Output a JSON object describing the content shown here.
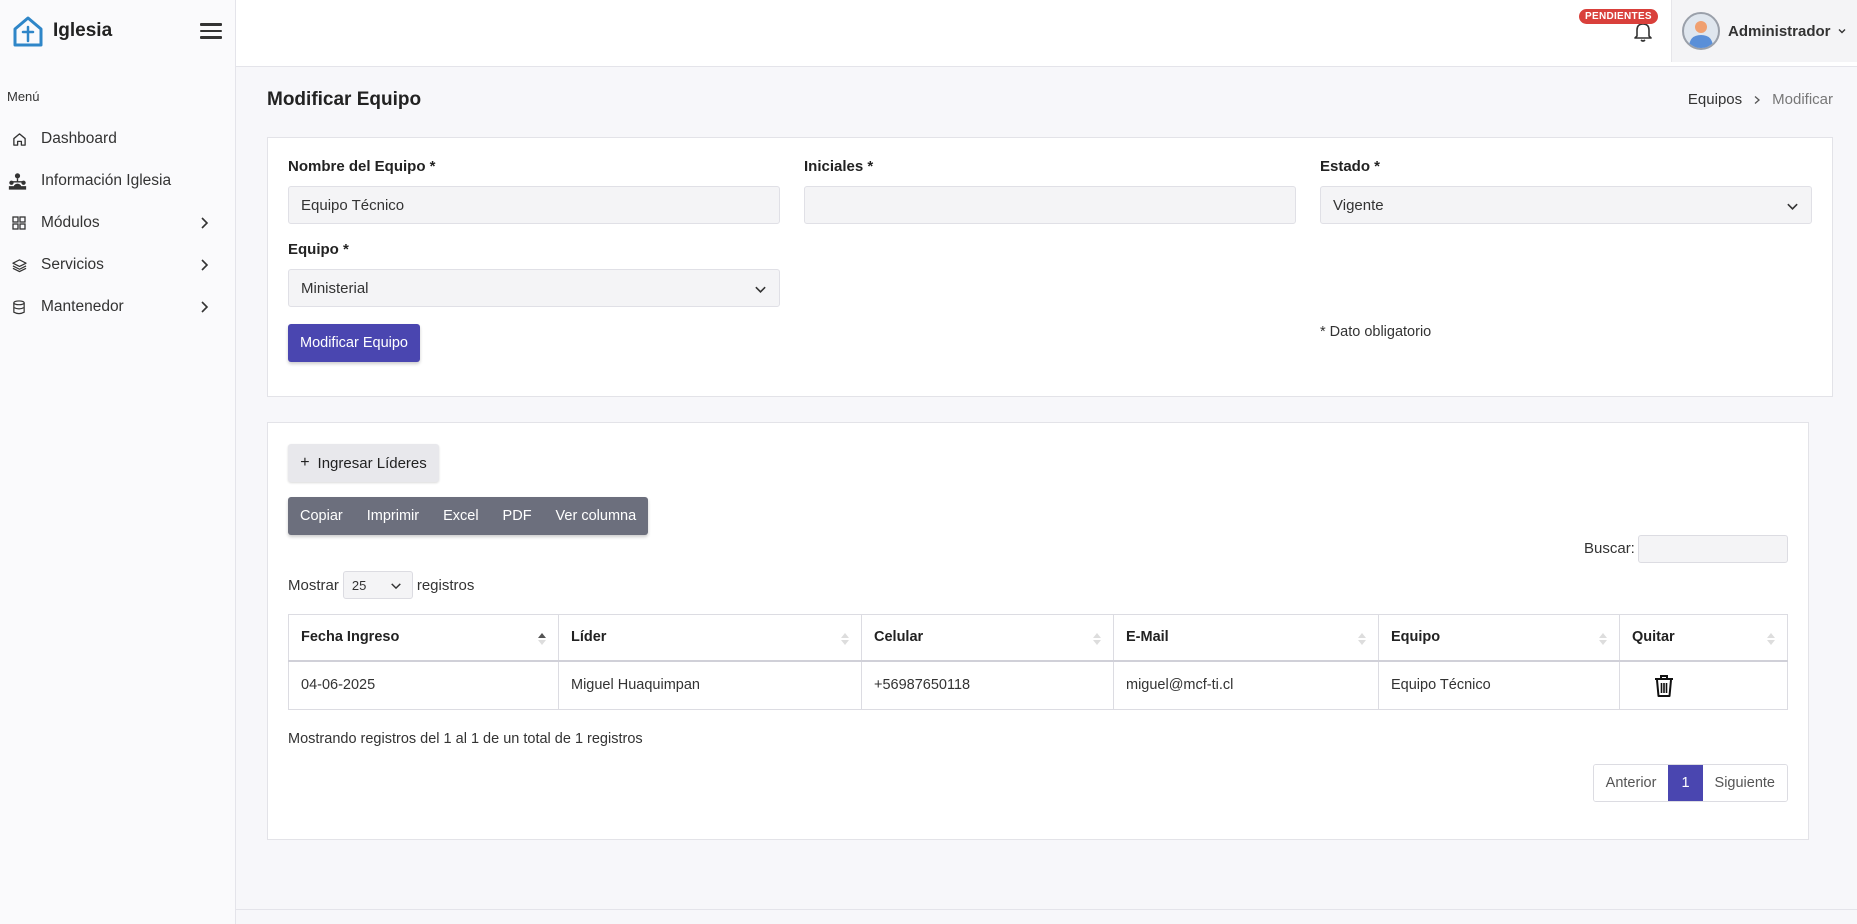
{
  "brand": {
    "name": "Iglesia"
  },
  "sidebar": {
    "menu_label": "Menú",
    "items": [
      {
        "label": "Dashboard",
        "icon": "home-icon",
        "has_children": false
      },
      {
        "label": "Información Iglesia",
        "icon": "church-org-icon",
        "has_children": false
      },
      {
        "label": "Módulos",
        "icon": "grid-icon",
        "has_children": true
      },
      {
        "label": "Servicios",
        "icon": "layers-icon",
        "has_children": true
      },
      {
        "label": "Mantenedor",
        "icon": "database-icon",
        "has_children": true
      }
    ]
  },
  "topbar": {
    "badge": "PENDIENTES",
    "user_name": "Administrador"
  },
  "page": {
    "title": "Modificar Equipo",
    "breadcrumb": [
      "Equipos",
      "Modificar"
    ]
  },
  "form": {
    "nombre_label": "Nombre del Equipo *",
    "nombre_value": "Equipo Técnico",
    "iniciales_label": "Iniciales *",
    "iniciales_value": "",
    "estado_label": "Estado *",
    "estado_value": "Vigente",
    "equipo_label": "Equipo *",
    "equipo_value": "Ministerial",
    "submit_label": "Modificar Equipo",
    "required_note": "* Dato obligatorio"
  },
  "leaders": {
    "add_label": "Ingresar Líderes",
    "export_buttons": [
      "Copiar",
      "Imprimir",
      "Excel",
      "PDF",
      "Ver columna"
    ],
    "search_label": "Buscar:",
    "length_prefix": "Mostrar",
    "length_value": "25",
    "length_suffix": "registros",
    "columns": [
      "Fecha Ingreso",
      "Líder",
      "Celular",
      "E-Mail",
      "Equipo",
      "Quitar"
    ],
    "rows": [
      {
        "fecha": "04-06-2025",
        "lider": "Miguel Huaquimpan",
        "celular": "+56987650118",
        "email": "miguel@mcf-ti.cl",
        "equipo": "Equipo Técnico"
      }
    ],
    "info": "Mostrando registros del 1 al 1 de un total de 1 registros",
    "pager": {
      "prev": "Anterior",
      "current": "1",
      "next": "Siguiente"
    }
  },
  "colors": {
    "primary": "#4a46b0",
    "badge": "#d9403b",
    "export_bg": "#6c6f7d",
    "logo": "#2f86c8"
  }
}
